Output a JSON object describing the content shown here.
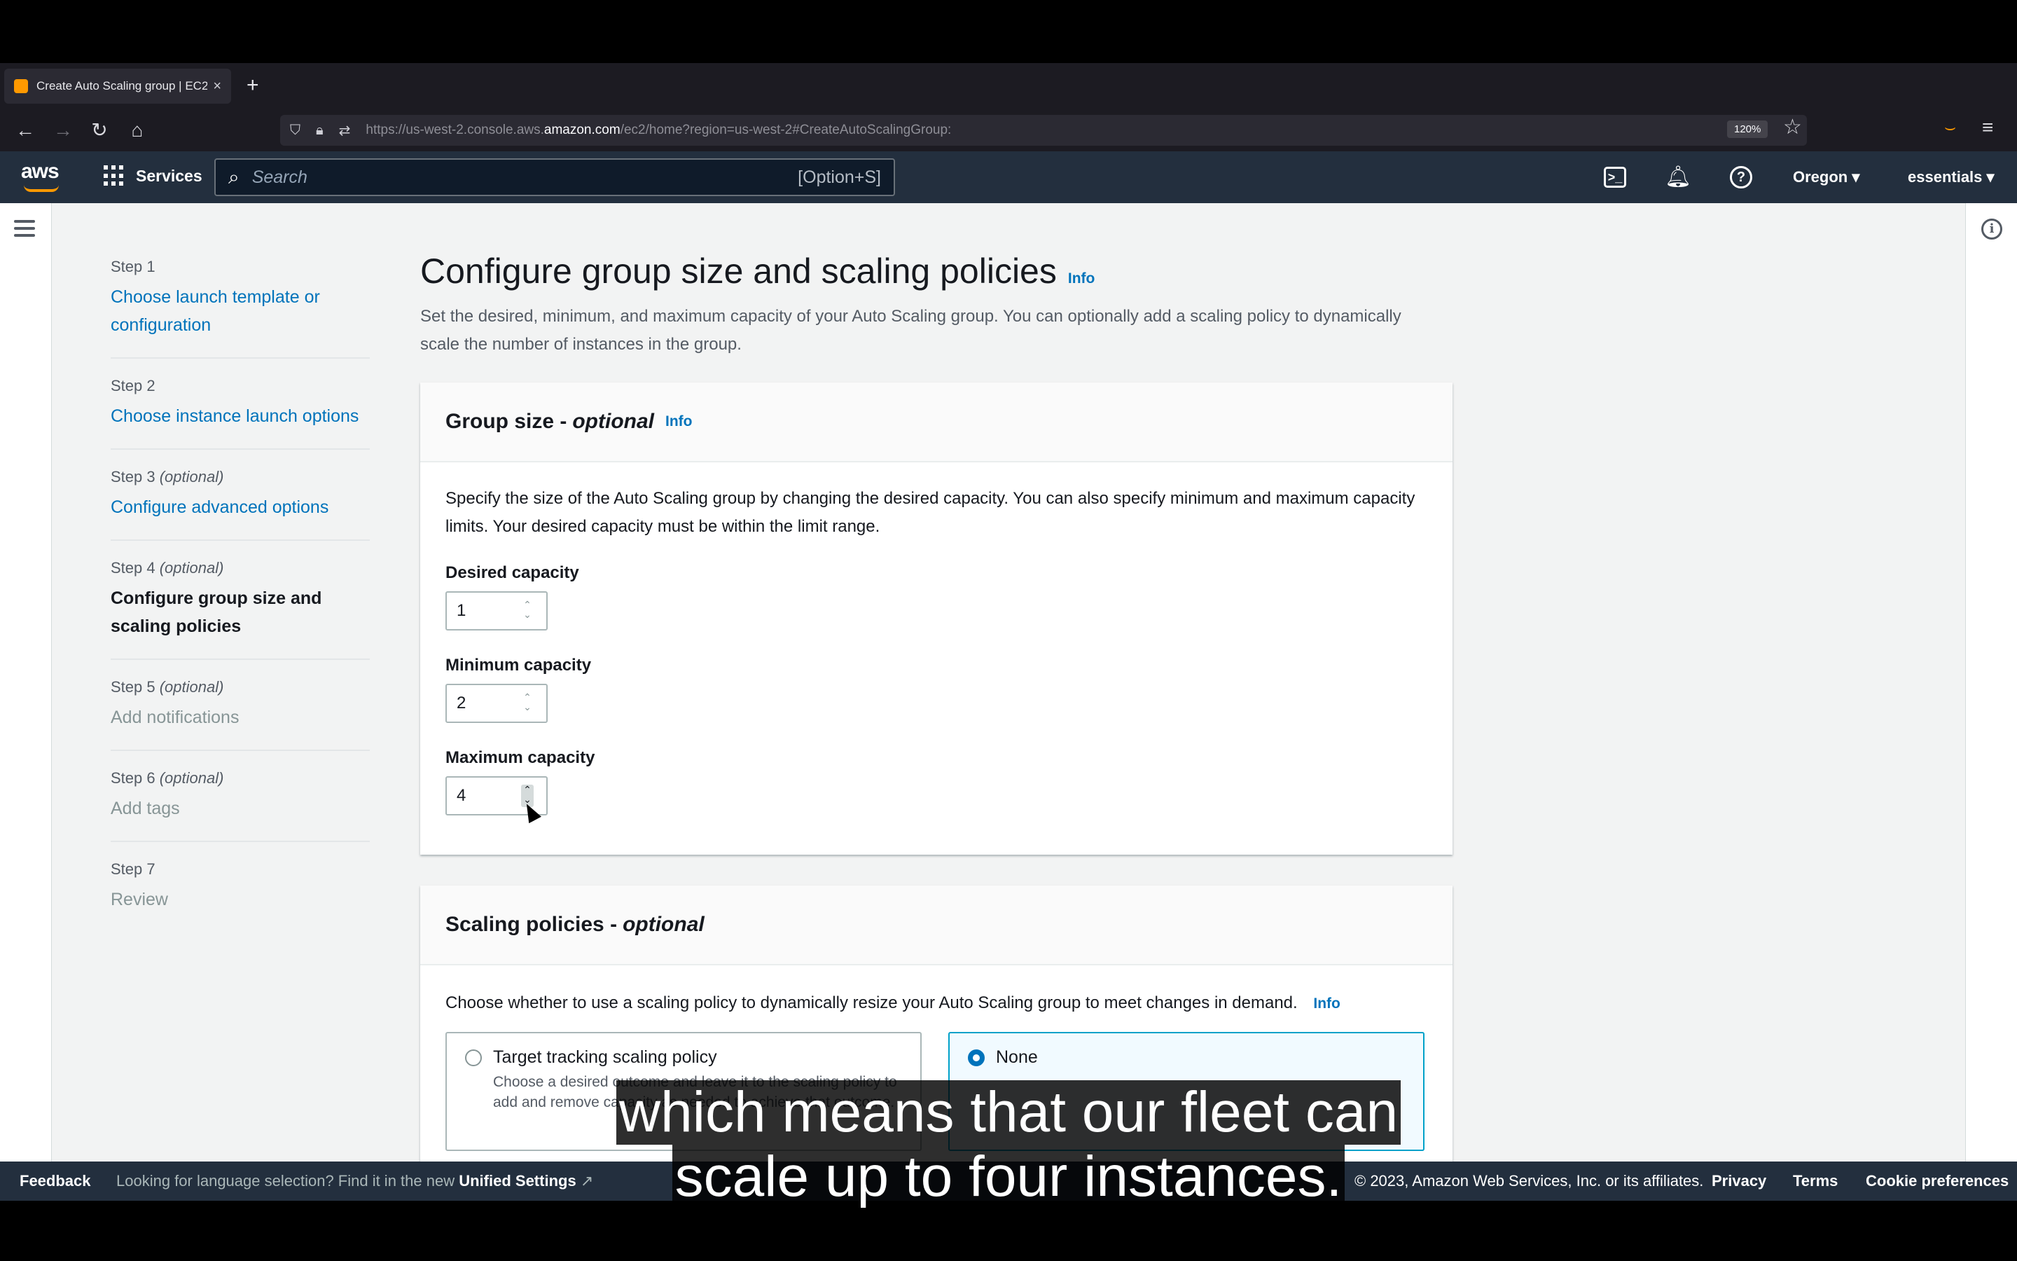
{
  "browser": {
    "tab_title": "Create Auto Scaling group | EC2",
    "tab_close": "×",
    "new_tab": "+",
    "url_prefix": "https://us-west-2.console.aws.",
    "url_host": "amazon.com",
    "url_path": "/ec2/home?region=us-west-2#CreateAutoScalingGroup:",
    "zoom": "120%"
  },
  "aws_header": {
    "logo": "aws",
    "services_label": "Services",
    "search_placeholder": "Search",
    "search_shortcut": "[Option+S]",
    "region": "Oregon ▾",
    "account": "essentials ▾"
  },
  "steps": [
    {
      "num": "Step 1",
      "optional": "",
      "label": "Choose launch template or configuration",
      "state": "link"
    },
    {
      "num": "Step 2",
      "optional": "",
      "label": "Choose instance launch options",
      "state": "link"
    },
    {
      "num": "Step 3",
      "optional": "(optional)",
      "label": "Configure advanced options",
      "state": "link"
    },
    {
      "num": "Step 4",
      "optional": "(optional)",
      "label": "Configure group size and scaling policies",
      "state": "current"
    },
    {
      "num": "Step 5",
      "optional": "(optional)",
      "label": "Add notifications",
      "state": "disabled"
    },
    {
      "num": "Step 6",
      "optional": "(optional)",
      "label": "Add tags",
      "state": "disabled"
    },
    {
      "num": "Step 7",
      "optional": "",
      "label": "Review",
      "state": "disabled"
    }
  ],
  "page": {
    "title": "Configure group size and scaling policies",
    "info": "Info",
    "description": "Set the desired, minimum, and maximum capacity of your Auto Scaling group. You can optionally add a scaling policy to dynamically scale the number of instances in the group."
  },
  "group_size": {
    "title": "Group size -",
    "title_optional": "optional",
    "info": "Info",
    "description": "Specify the size of the Auto Scaling group by changing the desired capacity. You can also specify minimum and maximum capacity limits. Your desired capacity must be within the limit range.",
    "desired_label": "Desired capacity",
    "desired_value": "1",
    "min_label": "Minimum capacity",
    "min_value": "2",
    "max_label": "Maximum capacity",
    "max_value": "4"
  },
  "scaling": {
    "title": "Scaling policies -",
    "title_optional": "optional",
    "description": "Choose whether to use a scaling policy to dynamically resize your Auto Scaling group to meet changes in demand.",
    "info": "Info",
    "option_target": "Target tracking scaling policy",
    "option_target_desc": "Choose a desired outcome and leave it to the scaling policy to add and remove capacity as needed to achieve that outcome.",
    "option_none": "None"
  },
  "footer": {
    "feedback": "Feedback",
    "lang_text": "Looking for language selection? Find it in the new",
    "unified": "Unified Settings",
    "copyright": "© 2023, Amazon Web Services, Inc. or its affiliates.",
    "privacy": "Privacy",
    "terms": "Terms",
    "cookies": "Cookie preferences"
  },
  "caption": {
    "line1": "which means that our fleet can",
    "line2": "scale up to four instances."
  },
  "colors": {
    "aws_navy": "#232f3e",
    "aws_orange": "#ff9900",
    "link_blue": "#0073bb"
  }
}
